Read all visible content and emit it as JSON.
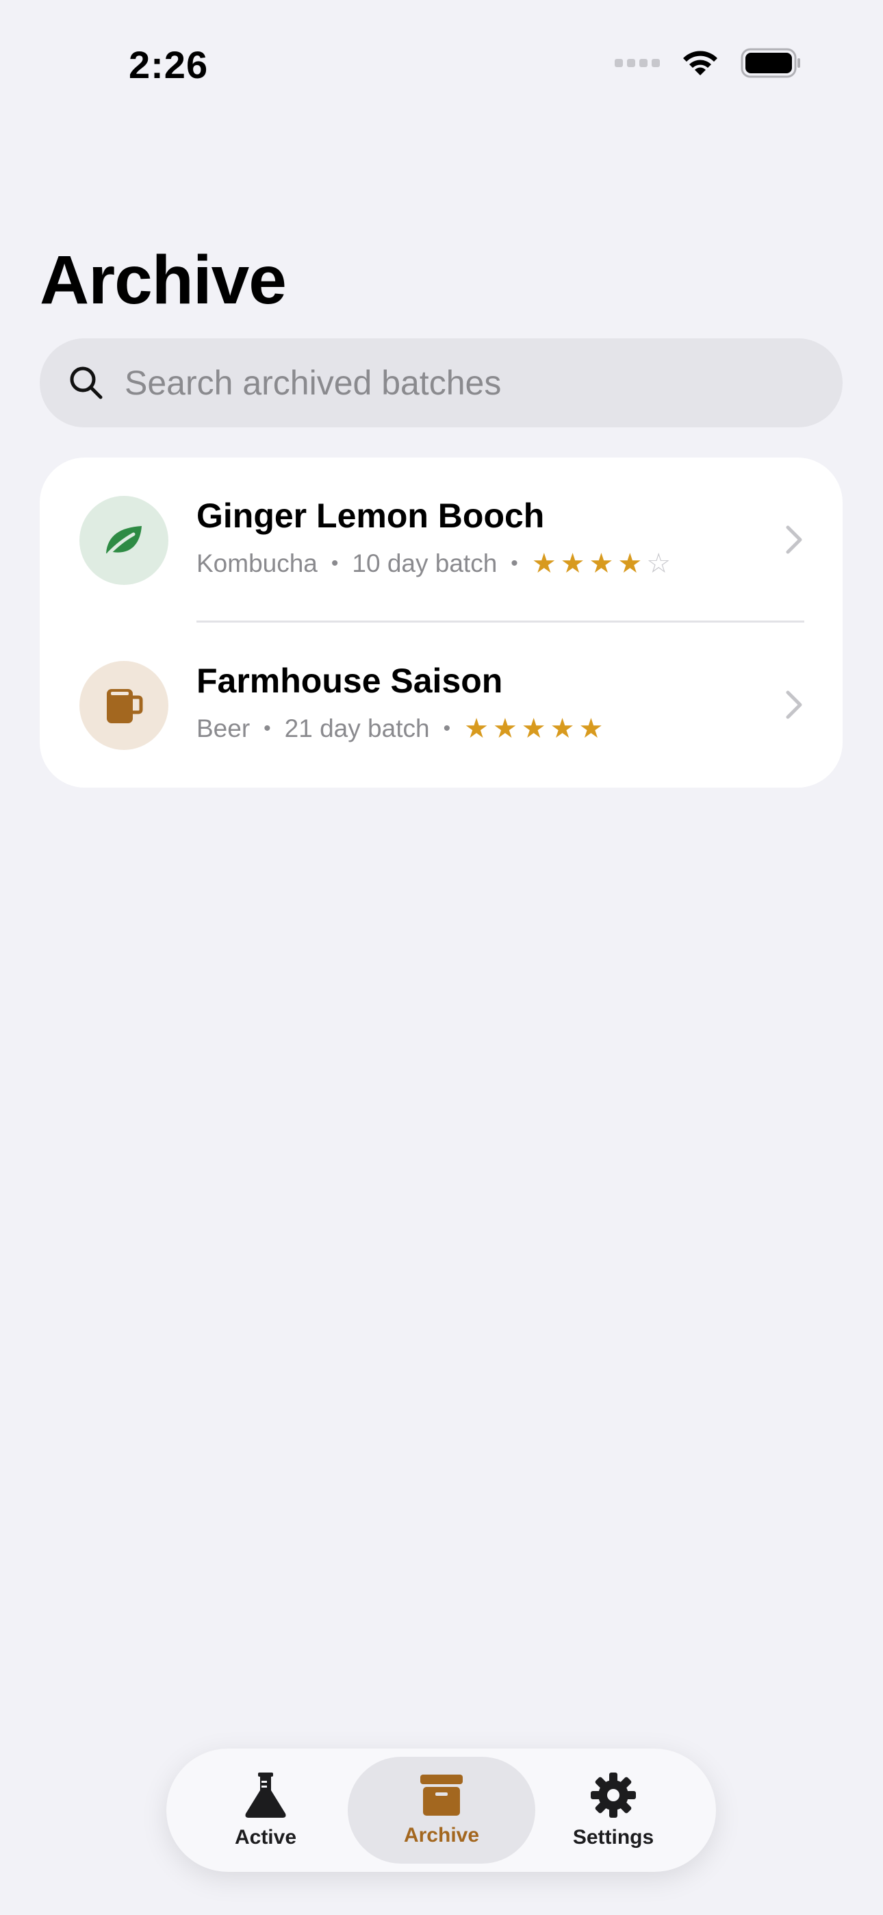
{
  "status_bar": {
    "time": "2:26"
  },
  "page": {
    "title": "Archive"
  },
  "search": {
    "placeholder": "Search archived batches",
    "value": ""
  },
  "batches": [
    {
      "name": "Ginger Lemon Booch",
      "type": "Kombucha",
      "duration": "10 day batch",
      "rating": 4,
      "rating_max": 5,
      "icon": "leaf-icon",
      "icon_color": "#2e8b44",
      "icon_bg": "#dfece2"
    },
    {
      "name": "Farmhouse Saison",
      "type": "Beer",
      "duration": "21 day batch",
      "rating": 5,
      "rating_max": 5,
      "icon": "mug-icon",
      "icon_color": "#a3671f",
      "icon_bg": "#f1e6da"
    }
  ],
  "tab_bar": {
    "tabs": [
      {
        "label": "Active",
        "icon": "flask-icon",
        "selected": false
      },
      {
        "label": "Archive",
        "icon": "archive-box-icon",
        "selected": true
      },
      {
        "label": "Settings",
        "icon": "gear-icon",
        "selected": false
      }
    ]
  },
  "colors": {
    "accent": "#a3671f",
    "star": "#d89a1e",
    "background": "#f2f2f7"
  }
}
